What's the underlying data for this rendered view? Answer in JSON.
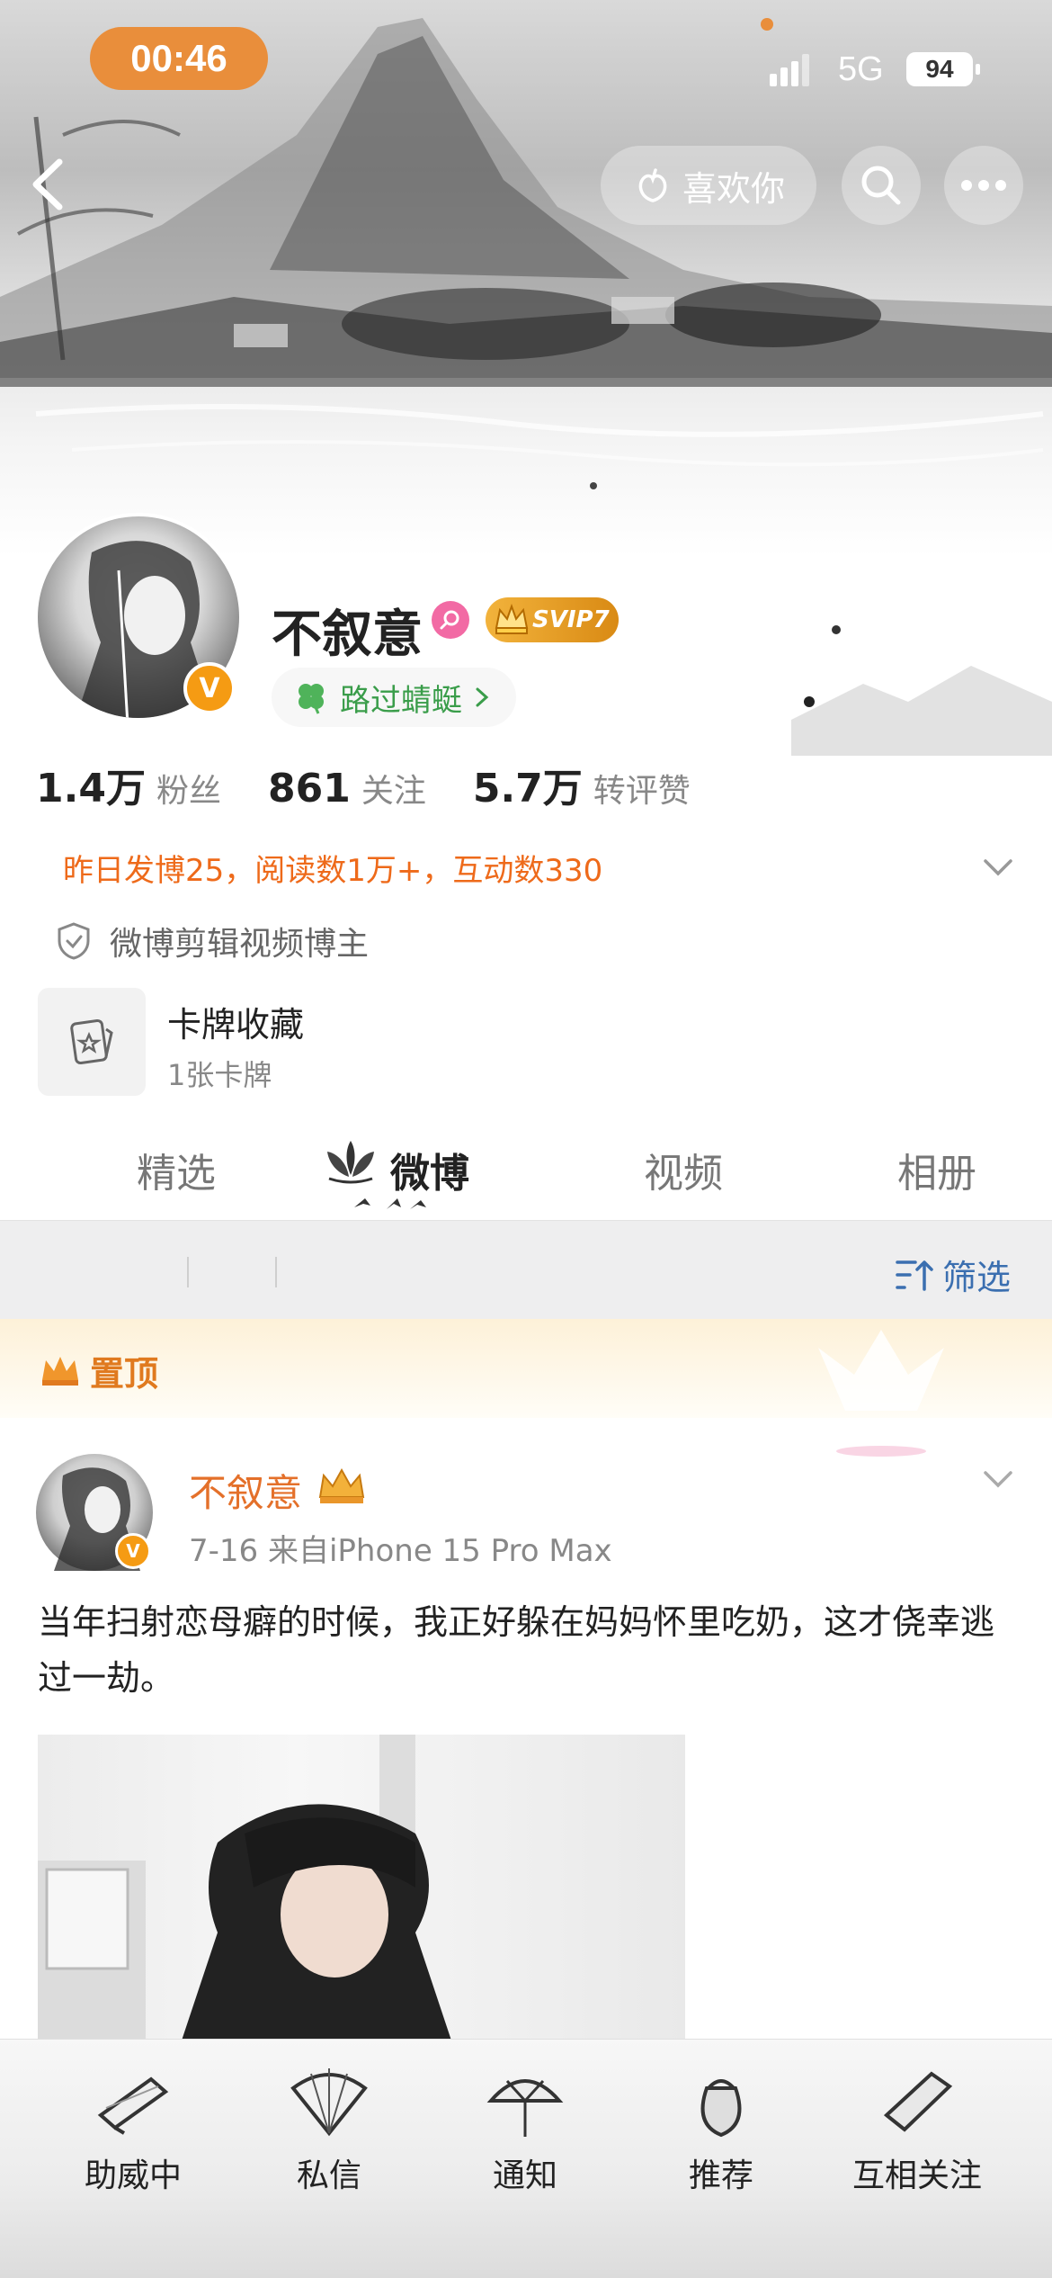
{
  "status_bar": {
    "time": "00:46",
    "network": "5G",
    "battery": "94"
  },
  "header": {
    "like_label": "喜欢你"
  },
  "profile": {
    "name": "不叙意",
    "vip_badge": "SVIP7",
    "passing_label": "路过蜻蜓",
    "stats": [
      {
        "value": "1.4万",
        "label": "粉丝"
      },
      {
        "value": "861",
        "label": "关注"
      },
      {
        "value": "5.7万",
        "label": "转评赞"
      }
    ],
    "summary": "昨日发博25，阅读数1万+，互动数330",
    "tag": "微博剪辑视频博主",
    "card": {
      "title": "卡牌收藏",
      "subtitle": "1张卡牌"
    }
  },
  "tabs": [
    "精选",
    "微博",
    "视频",
    "相册"
  ],
  "filter": {
    "label": "筛选"
  },
  "pinned": {
    "label": "置顶"
  },
  "post": {
    "author": "不叙意",
    "meta": "7-16  来自iPhone 15 Pro Max",
    "text": "当年扫射恋母癖的时候，我正好躲在妈妈怀里吃奶，这才侥幸逃过一劫。"
  },
  "bottom_bar": [
    "助威中",
    "私信",
    "通知",
    "推荐",
    "互相关注"
  ],
  "colors": {
    "accent_orange": "#ee6a1a",
    "time_pill": "#e98e3b",
    "badge_green": "#3a9d4a",
    "filter_blue": "#3b6fb0"
  }
}
